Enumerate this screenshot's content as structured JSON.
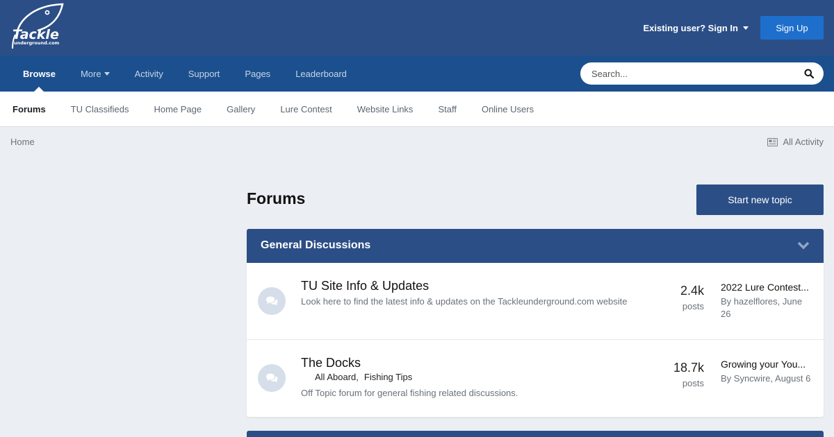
{
  "header": {
    "logo_text": "Tackle",
    "logo_subtext": "underground.com",
    "signin_label": "Existing user? Sign In",
    "signup_label": "Sign Up"
  },
  "primary_nav": {
    "items": [
      {
        "label": "Browse"
      },
      {
        "label": "More"
      },
      {
        "label": "Activity"
      },
      {
        "label": "Support"
      },
      {
        "label": "Pages"
      },
      {
        "label": "Leaderboard"
      }
    ],
    "search_placeholder": "Search..."
  },
  "secondary_nav": {
    "items": [
      {
        "label": "Forums"
      },
      {
        "label": "TU Classifieds"
      },
      {
        "label": "Home Page"
      },
      {
        "label": "Gallery"
      },
      {
        "label": "Lure Contest"
      },
      {
        "label": "Website Links"
      },
      {
        "label": "Staff"
      },
      {
        "label": "Online Users"
      }
    ]
  },
  "breadcrumb": {
    "home": "Home",
    "all_activity": "All Activity"
  },
  "page": {
    "title": "Forums",
    "start_topic_label": "Start new topic"
  },
  "category": {
    "title": "General Discussions",
    "forums": [
      {
        "title": "TU Site Info & Updates",
        "description": "Look here to find the latest info & updates on the Tackleunderground.com website",
        "subforums": [],
        "post_count": "2.4k",
        "post_label": "posts",
        "last_post_title": "2022 Lure Contest...",
        "last_post_by": "By hazelflores, June 26"
      },
      {
        "title": "The Docks",
        "description": "Off Topic forum for general fishing related discussions.",
        "subforums": [
          "All Aboard,",
          "Fishing Tips"
        ],
        "post_count": "18.7k",
        "post_label": "posts",
        "last_post_title": "Growing your You...",
        "last_post_by": "By Syncwire, August 6"
      }
    ]
  },
  "colors": {
    "header_bg": "#2b4e86",
    "primary_nav_bg": "#1c4f8d",
    "signup_bg": "#1e6fcc",
    "page_bg": "#ebeef2"
  }
}
